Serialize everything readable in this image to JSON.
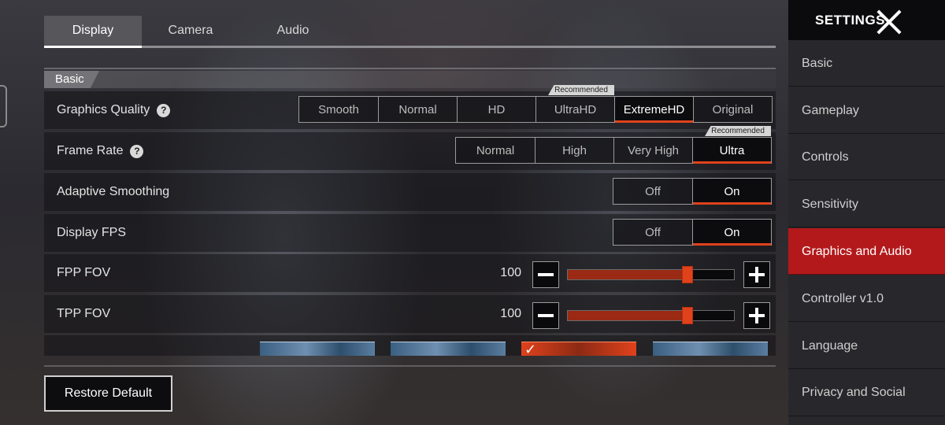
{
  "tabs": [
    {
      "label": "Display",
      "active": true
    },
    {
      "label": "Camera",
      "active": false
    },
    {
      "label": "Audio",
      "active": false
    }
  ],
  "section": {
    "label": "Basic"
  },
  "graphics_quality": {
    "label": "Graphics Quality",
    "options": [
      "Smooth",
      "Normal",
      "HD",
      "UltraHD",
      "ExtremeHD",
      "Original"
    ],
    "selected": "ExtremeHD",
    "recommended": "Recommended"
  },
  "frame_rate": {
    "label": "Frame Rate",
    "options": [
      "Normal",
      "High",
      "Very High",
      "Ultra"
    ],
    "selected": "Ultra",
    "recommended": "Recommended"
  },
  "adaptive_smoothing": {
    "label": "Adaptive Smoothing",
    "options": [
      "Off",
      "On"
    ],
    "selected": "On"
  },
  "display_fps": {
    "label": "Display FPS",
    "options": [
      "Off",
      "On"
    ],
    "selected": "On"
  },
  "fpp_fov": {
    "label": "FPP FOV",
    "value": "100",
    "fill_fraction": 0.72
  },
  "tpp_fov": {
    "label": "TPP FOV",
    "value": "100",
    "fill_fraction": 0.72
  },
  "crosshair_previews": {
    "count": 4,
    "selected_index": 2
  },
  "restore_default": {
    "label": "Restore Default"
  },
  "sidebar": {
    "title": "SETTINGS",
    "items": [
      {
        "label": "Basic",
        "active": false
      },
      {
        "label": "Gameplay",
        "active": false
      },
      {
        "label": "Controls",
        "active": false
      },
      {
        "label": "Sensitivity",
        "active": false
      },
      {
        "label": "Graphics and Audio",
        "active": true
      },
      {
        "label": "Controller v1.0",
        "active": false
      },
      {
        "label": "Language",
        "active": false
      },
      {
        "label": "Privacy and Social",
        "active": false
      }
    ]
  },
  "colors": {
    "accent": "#e0421c",
    "active_nav": "#b3191b"
  },
  "icons": {
    "help": "question-circle-icon",
    "close": "x-close-icon",
    "minus": "minus-icon",
    "plus": "plus-icon",
    "check": "check-icon"
  }
}
